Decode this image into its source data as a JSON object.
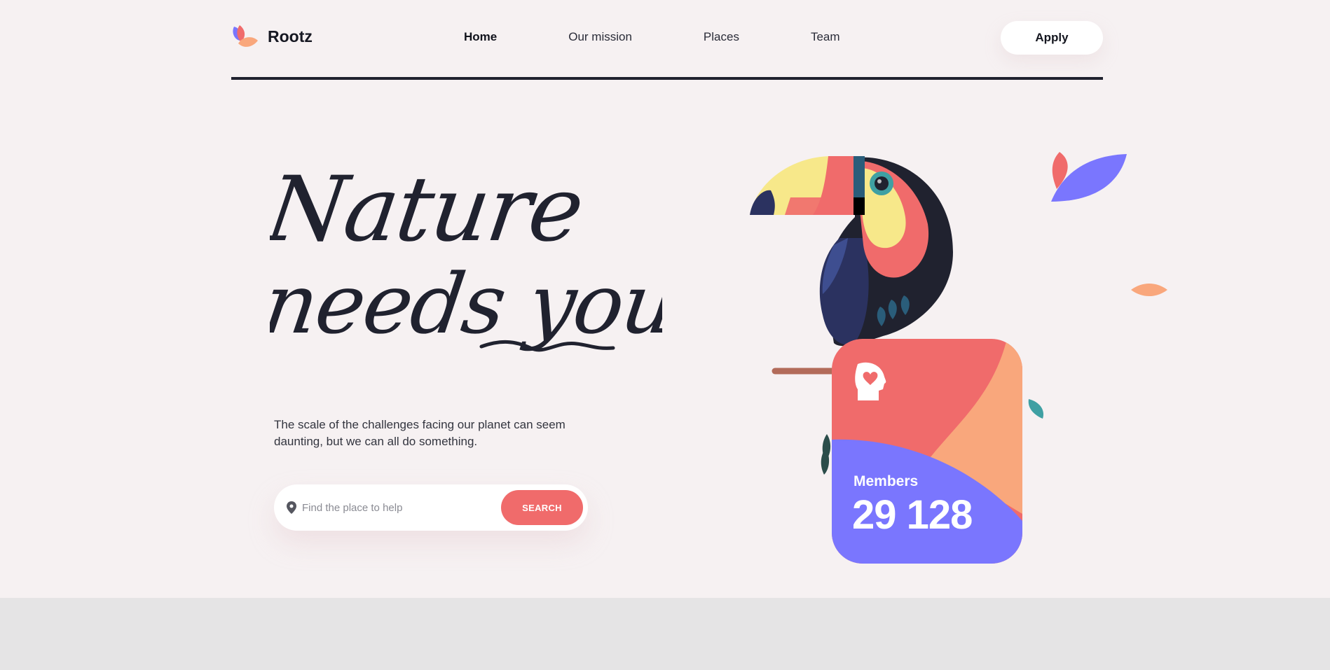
{
  "brand": {
    "name": "Rootz"
  },
  "nav": {
    "items": [
      {
        "label": "Home",
        "active": true
      },
      {
        "label": "Our mission",
        "active": false
      },
      {
        "label": "Places",
        "active": false
      },
      {
        "label": "Team",
        "active": false
      }
    ],
    "apply_label": "Apply"
  },
  "hero": {
    "title_line1": "Nature",
    "title_line2": "needs you",
    "description": "The scale of the challenges facing our planet can seem daunting, but we can all do something."
  },
  "search": {
    "placeholder": "Find the place to help",
    "value": "",
    "button_label": "SEARCH"
  },
  "members": {
    "label": "Members",
    "count": "29 128"
  },
  "colors": {
    "background": "#f6f1f2",
    "ink": "#20222f",
    "coral": "#f06b6b",
    "peach": "#f9a77c",
    "periwinkle": "#7a76fe",
    "yellow": "#f7e88a",
    "teal": "#3fa0a3",
    "footer": "#e5e4e5"
  },
  "icons": [
    "logo-petals-icon",
    "location-pin-icon",
    "head-heart-icon",
    "toucan-illustration",
    "leaf-icon"
  ]
}
